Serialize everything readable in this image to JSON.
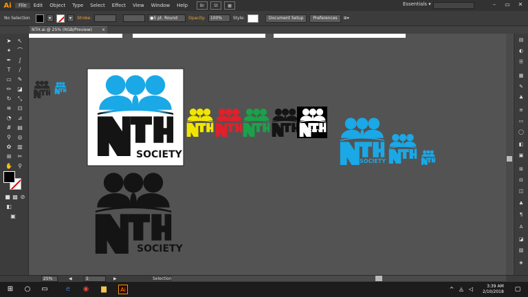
{
  "app": {
    "logo": "Ai",
    "workspace": "Essentials",
    "bridge_label": "Br",
    "stock_label": "St"
  },
  "menu": [
    "File",
    "Edit",
    "Object",
    "Type",
    "Select",
    "Effect",
    "View",
    "Window",
    "Help"
  ],
  "control": {
    "selection": "No Selection",
    "stroke_label": "Stroke:",
    "brush": "5 pt. Round",
    "opacity_label": "Opacity:",
    "opacity_value": "100%",
    "style_label": "Style:",
    "doc_setup": "Document Setup",
    "preferences": "Preferences"
  },
  "document": {
    "tab_title": "NTH.ai @ 25% (RGB/Preview)"
  },
  "logo": {
    "big": "NTH",
    "small": "SOCIETY"
  },
  "colors": {
    "blue": "#1ba8e6",
    "yellow": "#f2e600",
    "red": "#e0202a",
    "green": "#1aa14a",
    "black": "#141414",
    "white": "#ffffff",
    "dark": "#2a2a2a"
  },
  "status": {
    "zoom": "25%",
    "artboard": "1",
    "mode": "Selection"
  },
  "taskbar": {
    "time": "3:39 AM",
    "date": "2/10/2018"
  },
  "icons": [
    "selection-tool-icon",
    "direct-selection-tool-icon",
    "magic-wand-icon",
    "lasso-icon",
    "pen-tool-icon",
    "curvature-icon",
    "type-tool-icon",
    "line-tool-icon",
    "rectangle-tool-icon",
    "paintbrush-icon",
    "pencil-icon",
    "eraser-icon",
    "rotate-icon",
    "scale-icon",
    "width-tool-icon",
    "free-transform-icon",
    "shape-builder-icon",
    "perspective-grid-icon",
    "mesh-icon",
    "gradient-icon",
    "eyedropper-icon",
    "blend-icon",
    "symbol-sprayer-icon",
    "column-graph-icon",
    "artboard-tool-icon",
    "slice-icon",
    "hand-icon",
    "zoom-icon"
  ]
}
